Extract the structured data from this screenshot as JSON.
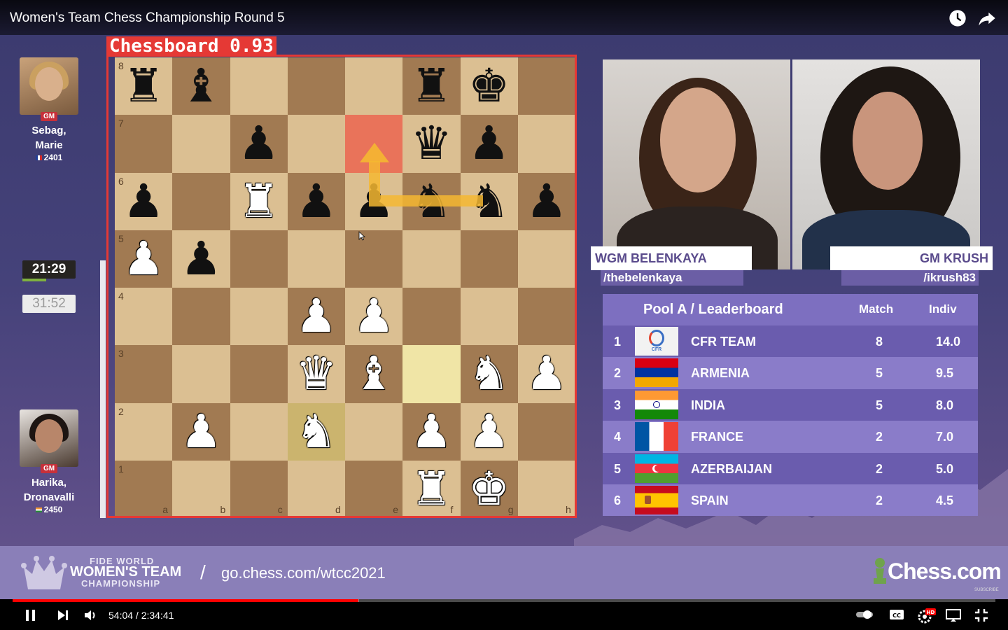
{
  "video": {
    "title": "Women's Team Chess Championship Round 5",
    "time_current": "54:04",
    "time_total": "2:34:41",
    "time_display": "54:04 / 2:34:41",
    "progress": 0.35
  },
  "detection": {
    "label": "Chessboard 0.93"
  },
  "players": {
    "top": {
      "title": "GM",
      "name_line1": "Sebag,",
      "name_line2": "Marie",
      "rating": "2401",
      "flag": "France"
    },
    "bottom": {
      "title": "GM",
      "name_line1": "Harika,",
      "name_line2": "Dronavalli",
      "rating": "2450",
      "flag": "India"
    }
  },
  "clocks": {
    "active": "21:29",
    "inactive": "31:52"
  },
  "board": {
    "files": [
      "a",
      "b",
      "c",
      "d",
      "e",
      "f",
      "g",
      "h"
    ],
    "ranks": [
      "8",
      "7",
      "6",
      "5",
      "4",
      "3",
      "2",
      "1"
    ],
    "pieces": [
      {
        "sq": "a8",
        "p": "r"
      },
      {
        "sq": "b8",
        "p": "b"
      },
      {
        "sq": "f8",
        "p": "r"
      },
      {
        "sq": "g8",
        "p": "k"
      },
      {
        "sq": "c7",
        "p": "p"
      },
      {
        "sq": "f7",
        "p": "q"
      },
      {
        "sq": "g7",
        "p": "p"
      },
      {
        "sq": "a6",
        "p": "p"
      },
      {
        "sq": "c6",
        "p": "R"
      },
      {
        "sq": "d6",
        "p": "p"
      },
      {
        "sq": "e6",
        "p": "p"
      },
      {
        "sq": "f6",
        "p": "n"
      },
      {
        "sq": "g6",
        "p": "n"
      },
      {
        "sq": "h6",
        "p": "p"
      },
      {
        "sq": "a5",
        "p": "P"
      },
      {
        "sq": "b5",
        "p": "p"
      },
      {
        "sq": "d4",
        "p": "P"
      },
      {
        "sq": "e4",
        "p": "P"
      },
      {
        "sq": "d3",
        "p": "Q"
      },
      {
        "sq": "e3",
        "p": "B"
      },
      {
        "sq": "g3",
        "p": "N"
      },
      {
        "sq": "h3",
        "p": "P"
      },
      {
        "sq": "b2",
        "p": "P"
      },
      {
        "sq": "d2",
        "p": "N"
      },
      {
        "sq": "f2",
        "p": "P"
      },
      {
        "sq": "g2",
        "p": "P"
      },
      {
        "sq": "f1",
        "p": "R"
      },
      {
        "sq": "g1",
        "p": "K"
      }
    ],
    "highlights": [
      {
        "sq": "e7",
        "color": "red"
      },
      {
        "sq": "f3",
        "color": "yellow"
      },
      {
        "sq": "d2",
        "color": "yellow-dark"
      }
    ],
    "arrow": {
      "from": "g6",
      "via": "e6",
      "to": "e7"
    }
  },
  "webcams": {
    "left": {
      "name": "WGM BELENKAYA",
      "handle": "/thebelenkaya"
    },
    "right": {
      "name": "GM KRUSH",
      "handle": "/ikrush83"
    }
  },
  "leaderboard": {
    "title": "Pool A / Leaderboard",
    "col_match": "Match",
    "col_indiv": "Indiv",
    "rows": [
      {
        "rank": "1",
        "team": "CFR TEAM",
        "match": "8",
        "indiv": "14.0",
        "flag": "cfr-logo"
      },
      {
        "rank": "2",
        "team": "ARMENIA",
        "match": "5",
        "indiv": "9.5",
        "flag": "armenia-flag"
      },
      {
        "rank": "3",
        "team": "INDIA",
        "match": "5",
        "indiv": "8.0",
        "flag": "india-flag"
      },
      {
        "rank": "4",
        "team": "FRANCE",
        "match": "2",
        "indiv": "7.0",
        "flag": "france-flag"
      },
      {
        "rank": "5",
        "team": "AZERBAIJAN",
        "match": "2",
        "indiv": "5.0",
        "flag": "azerbaijan-flag"
      },
      {
        "rank": "6",
        "team": "SPAIN",
        "match": "2",
        "indiv": "4.5",
        "flag": "spain-flag"
      }
    ],
    "cfr_logo_text": "CFR"
  },
  "banner": {
    "line1": "FIDE WORLD",
    "line2": "WOMEN'S TEAM",
    "line3": "CHAMPIONSHIP",
    "slash": "/",
    "url": "go.chess.com/wtcc2021",
    "logo": "Chess.com",
    "subscribe": "SUBSCRIBE"
  },
  "controls": {
    "hd_badge": "HD",
    "cc_label": "CC"
  },
  "icons": [
    "clock-icon",
    "share-icon",
    "pause-icon",
    "next-icon",
    "volume-icon",
    "autoplay-toggle-icon",
    "captions-icon",
    "settings-icon",
    "cast-icon",
    "fullscreen-exit-icon",
    "cursor-icon"
  ]
}
